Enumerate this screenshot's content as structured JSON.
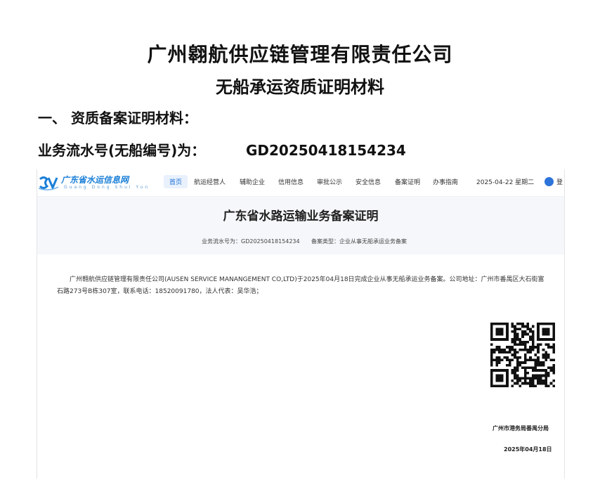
{
  "doc": {
    "company_title": "广州翱航供应链管理有限责任公司",
    "subtitle": "无船承运资质证明材料",
    "section_heading": "一、 资质备案证明材料：",
    "serial_label": "业务流水号(无船编号)为：",
    "serial_value": "GD20250418154234"
  },
  "site": {
    "logo_text": "广东省水运信息网",
    "logo_sub": "Guang  Dong  Shui  Yun",
    "nav": [
      "首页",
      "航运经营人",
      "辅助企业",
      "信用信息",
      "审批公示",
      "安全信息",
      "备案证明",
      "办事指南"
    ],
    "date": "2025-04-22 星期二",
    "login": "登"
  },
  "cert": {
    "title": "广东省水路运输业务备案证明",
    "serial_meta": "业务流水号为：GD20250418154234",
    "type_meta": "备案类型：企业从事无船承运业务备案",
    "body": "广州翱航供应链管理有限责任公司(AUSEN SERVICE MANANGEMENT CO,LTD)于2025年04月18日完成企业从事无船承运业务备案。公司地址：广州市番禺区大石街富石路273号B栋307室，联系电话：18520091780，法人代表：吴华浩；",
    "issuer": "广州市港务局番禺分局",
    "issue_date": "2025年04月18日"
  }
}
